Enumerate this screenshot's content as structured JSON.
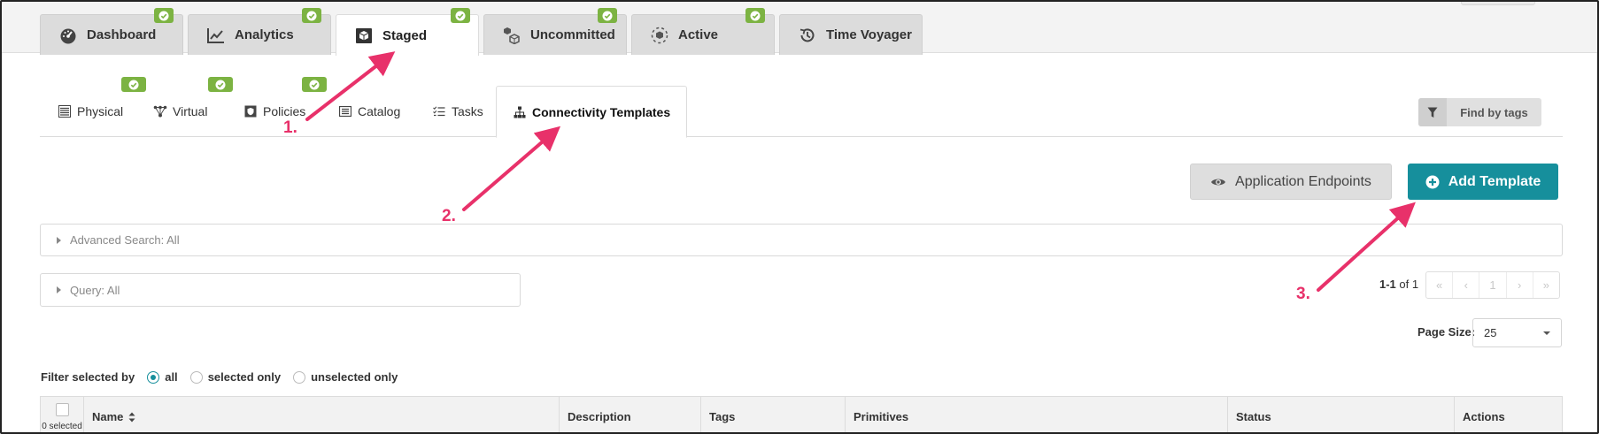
{
  "main_tabs": [
    {
      "label": "Dashboard",
      "icon": "dashboard-gauge-icon",
      "checked": true
    },
    {
      "label": "Analytics",
      "icon": "line-chart-icon",
      "checked": true
    },
    {
      "label": "Staged",
      "icon": "cube-icon",
      "checked": true,
      "active": true
    },
    {
      "label": "Uncommitted",
      "icon": "cubes-icon",
      "checked": true
    },
    {
      "label": "Active",
      "icon": "cube-dashed-icon",
      "checked": true
    },
    {
      "label": "Time Voyager",
      "icon": "history-icon",
      "checked": false
    }
  ],
  "sub_tabs": [
    {
      "label": "Physical",
      "icon": "rack-icon",
      "checked": true
    },
    {
      "label": "Virtual",
      "icon": "network-icon",
      "checked": true
    },
    {
      "label": "Policies",
      "icon": "shield-icon",
      "checked": true
    },
    {
      "label": "Catalog",
      "icon": "list-icon",
      "checked": false
    },
    {
      "label": "Tasks",
      "icon": "tasks-icon",
      "checked": false
    },
    {
      "label": "Connectivity Templates",
      "icon": "sitemap-icon",
      "checked": false,
      "active": true
    }
  ],
  "find_by_tags": {
    "label": "Find by tags",
    "icon": "filter-icon"
  },
  "actions": {
    "app_endpoints_label": "Application Endpoints",
    "app_endpoints_icon": "eye-icon",
    "add_template_label": "Add Template",
    "add_template_icon": "plus-circle-icon"
  },
  "advanced_search": {
    "label": "Advanced Search: All"
  },
  "query": {
    "label": "Query: All"
  },
  "pagination": {
    "range": "1-1",
    "of_text": "of 1",
    "first": "«",
    "prev": "‹",
    "page": "1",
    "next": "›",
    "last": "»"
  },
  "page_size": {
    "label": "Page Size:",
    "value": "25"
  },
  "filter": {
    "label": "Filter selected by",
    "options": [
      {
        "label": "all",
        "selected": true
      },
      {
        "label": "selected only",
        "selected": false
      },
      {
        "label": "unselected only",
        "selected": false
      }
    ]
  },
  "table": {
    "selected_count": "0 selected",
    "columns": [
      "Name",
      "Description",
      "Tags",
      "Primitives",
      "Status",
      "Actions"
    ]
  },
  "annotations": [
    "1.",
    "2.",
    "3."
  ],
  "colors": {
    "accent": "#168f9c",
    "check_green": "#7cb342",
    "annotation_pink": "#e8316a"
  }
}
